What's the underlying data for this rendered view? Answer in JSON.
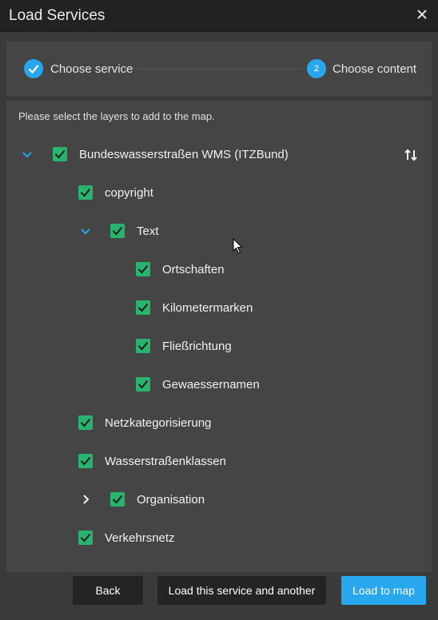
{
  "window": {
    "title": "Load Services"
  },
  "stepper": {
    "step1": {
      "label": "Choose service",
      "state": "completed"
    },
    "step2": {
      "label": "Choose content",
      "number": "2",
      "state": "active"
    }
  },
  "content": {
    "instruction": "Please select the layers to add to the map.",
    "layers": [
      {
        "label": "Bundeswasserstraßen WMS (ITZBund)",
        "checked": true,
        "expanded": true
      },
      {
        "label": "copyright",
        "checked": true
      },
      {
        "label": "Text",
        "checked": true,
        "expanded": true
      },
      {
        "label": "Ortschaften",
        "checked": true
      },
      {
        "label": "Kilometermarken",
        "checked": true
      },
      {
        "label": "Fließrichtung",
        "checked": true
      },
      {
        "label": "Gewaessernamen",
        "checked": true
      },
      {
        "label": "Netzkategorisierung",
        "checked": true
      },
      {
        "label": "Wasserstraßenklassen",
        "checked": true
      },
      {
        "label": "Organisation",
        "checked": true,
        "expanded": false
      },
      {
        "label": "Verkehrsnetz",
        "checked": true
      }
    ]
  },
  "footer": {
    "back_label": "Back",
    "load_another_label": "Load this service and another",
    "load_label": "Load to map"
  },
  "colors": {
    "accent": "#28a7ef",
    "checkbox": "#29b36f",
    "titlebar": "#222222",
    "panel": "#454545"
  }
}
